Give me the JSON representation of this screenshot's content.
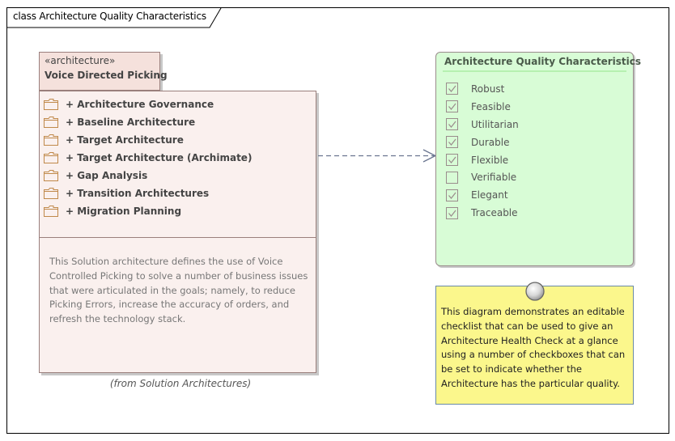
{
  "frame": {
    "title": "class Architecture Quality Characteristics"
  },
  "package": {
    "stereotype": "«architecture»",
    "name": "Voice Directed Picking",
    "items": [
      {
        "label": "+ Architecture Governance",
        "icon": "folder-icon"
      },
      {
        "label": "+ Baseline Architecture",
        "icon": "folder-icon"
      },
      {
        "label": "+ Target Architecture",
        "icon": "folder-icon"
      },
      {
        "label": "+ Target Architecture (Archimate)",
        "icon": "folder-icon"
      },
      {
        "label": "+ Gap Analysis",
        "icon": "folder-icon"
      },
      {
        "label": "+ Transition Architectures",
        "icon": "folder-icon"
      },
      {
        "label": "+ Migration Planning",
        "icon": "folder-icon"
      }
    ],
    "notes": "This Solution architecture defines the use of Voice Controlled Picking to solve a number of business issues that were articulated in the goals; namely, to reduce Picking Errors, increase the accuracy of orders, and refresh the technology stack.",
    "from": "(from Solution Architectures)"
  },
  "connector": {
    "type": "dependency",
    "style": "dashed-open-arrow",
    "color": "#6a7590"
  },
  "checklist": {
    "title": "Architecture Quality Characteristics",
    "items": [
      {
        "label": "Robust",
        "checked": true
      },
      {
        "label": "Feasible",
        "checked": true
      },
      {
        "label": "Utilitarian",
        "checked": true
      },
      {
        "label": "Durable",
        "checked": true
      },
      {
        "label": "Flexible",
        "checked": true
      },
      {
        "label": "Verifiable",
        "checked": false
      },
      {
        "label": "Elegant",
        "checked": true
      },
      {
        "label": "Traceable",
        "checked": true
      }
    ]
  },
  "note": {
    "text": "This diagram demonstrates an editable checklist that can be used to give an Architecture Health Check at a glance using a number of checkboxes that can be set to indicate whether the Architecture has the particular quality."
  },
  "colors": {
    "package_fill": "#faf0ee",
    "package_tab_fill": "#f5e1dc",
    "checklist_fill": "#d8fcd6",
    "note_fill": "#fbf78c",
    "folder_stroke": "#c0894a"
  }
}
